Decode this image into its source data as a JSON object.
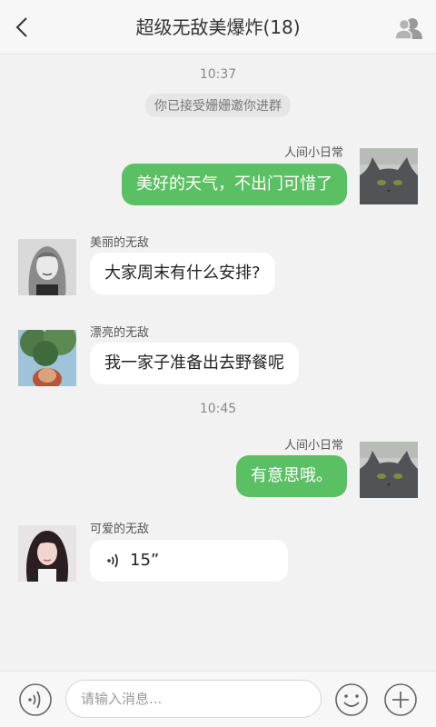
{
  "header": {
    "title": "超级无敌美爆炸(18)",
    "back_icon": "chevron-left-icon",
    "members_icon": "group-members-icon"
  },
  "messages": [
    {
      "type": "time",
      "text": "10:37"
    },
    {
      "type": "notice",
      "text": "你已接受姗姗邀你进群"
    },
    {
      "type": "outgoing",
      "sender": "人间小日常",
      "text": "美好的天气，不出门可惜了",
      "avatar": "gray-cat-avatar"
    },
    {
      "type": "incoming",
      "sender": "美丽的无敌",
      "text": "大家周末有什么安排?",
      "avatar": "woman-portrait-avatar"
    },
    {
      "type": "incoming",
      "sender": "漂亮的无敌",
      "text": "我一家子准备出去野餐呢",
      "avatar": "tree-sky-avatar"
    },
    {
      "type": "time",
      "text": "10:45"
    },
    {
      "type": "outgoing",
      "sender": "人间小日常",
      "text": "有意思哦。",
      "avatar": "gray-cat-avatar"
    },
    {
      "type": "incoming-voice",
      "sender": "可爱的无敌",
      "duration": "15”",
      "avatar": "girl-portrait-avatar"
    }
  ],
  "input_bar": {
    "placeholder": "请输入消息...",
    "voice_icon": "voice-input-icon",
    "emoji_icon": "emoji-icon",
    "plus_icon": "plus-icon"
  },
  "colors": {
    "outgoing_bubble": "#5bbf63",
    "incoming_bubble": "#ffffff",
    "background": "#f2f2f2",
    "header": "#f7f7f7"
  }
}
